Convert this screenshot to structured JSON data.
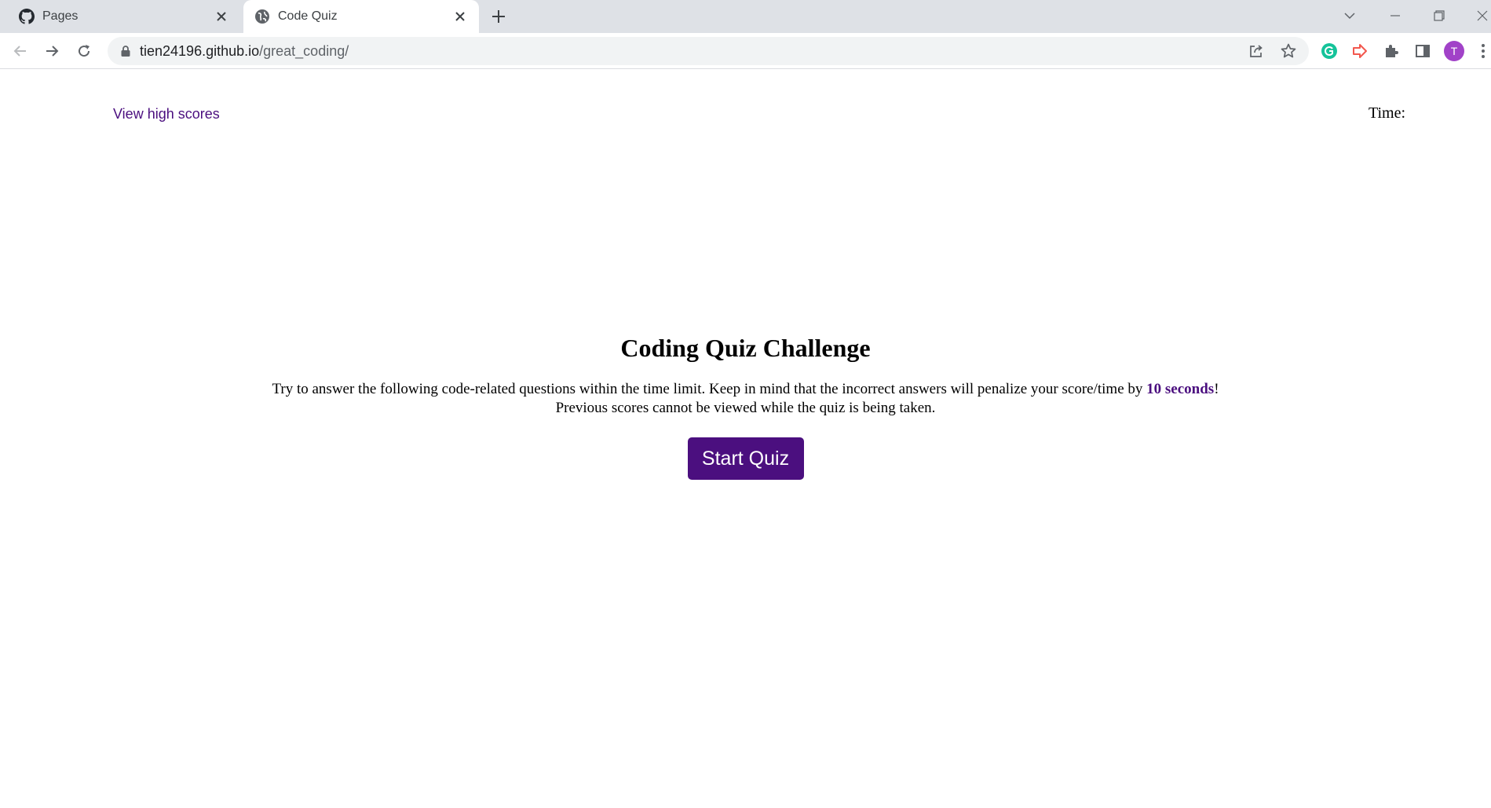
{
  "browser": {
    "tabs": [
      {
        "title": "Pages",
        "icon": "github-icon",
        "active": false
      },
      {
        "title": "Code Quiz",
        "icon": "globe-icon",
        "active": true
      }
    ],
    "address": {
      "host": "tien24196.github.io",
      "path": "/great_coding/"
    },
    "profile_initial": "T"
  },
  "header": {
    "high_scores_link": "View high scores",
    "timer_label": "Time:",
    "timer_value": ""
  },
  "intro": {
    "title": "Coding Quiz Challenge",
    "line1_before": "Try to answer the following code-related questions within the time limit. Keep in mind that the incorrect answers will penalize your score/time by ",
    "line1_highlight": "10 seconds",
    "line1_after": "!",
    "line2": "Previous scores cannot be viewed while the quiz is being taken.",
    "start_button": "Start Quiz"
  },
  "colors": {
    "accent": "#4b0f7f",
    "tabstrip": "#dee1e6",
    "omnibox": "#f1f3f4",
    "avatar": "#a142c8"
  }
}
